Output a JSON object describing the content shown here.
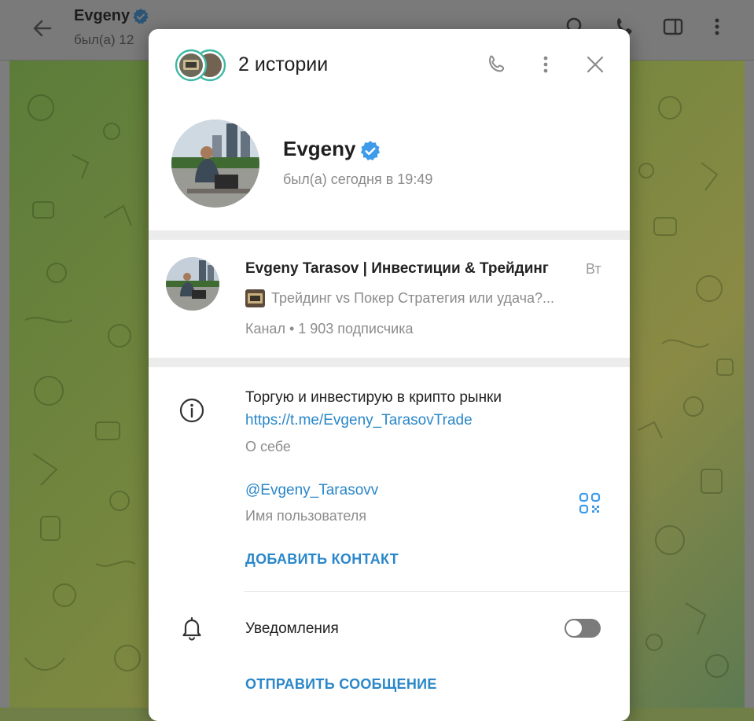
{
  "background": {
    "contact_name": "Evgeny",
    "contact_status": "был(а) 12"
  },
  "modal": {
    "stories_label": "2 истории",
    "profile": {
      "name": "Evgeny",
      "status": "был(а) сегодня в 19:49"
    },
    "channel": {
      "name": "Evgeny Tarasov | Инвестиции & Трейдинг",
      "time": "Вт",
      "preview": "Трейдинг vs Покер Стратегия или удача?...",
      "meta": "Канал • 1 903 подписчика"
    },
    "bio": {
      "text": "Торгую и инвестирую в крипто рынки",
      "link": "https://t.me/Evgeny_TarasovTrade",
      "label": "О себе"
    },
    "username": {
      "value": "@Evgeny_Tarasovv",
      "label": "Имя пользователя"
    },
    "add_contact_label": "ДОБАВИТЬ КОНТАКТ",
    "notifications": {
      "label": "Уведомления",
      "enabled": false
    },
    "send_message_label": "ОТПРАВИТЬ СООБЩЕНИЕ"
  },
  "colors": {
    "accent": "#2a87c9",
    "verified": "#3d9be9",
    "toggle_off": "#7b7b7b"
  },
  "icons": [
    "back-arrow-icon",
    "verified-icon",
    "search-icon",
    "phone-icon",
    "sidebar-icon",
    "more-vertical-icon",
    "close-icon",
    "info-icon",
    "qr-code-icon",
    "bell-icon"
  ]
}
